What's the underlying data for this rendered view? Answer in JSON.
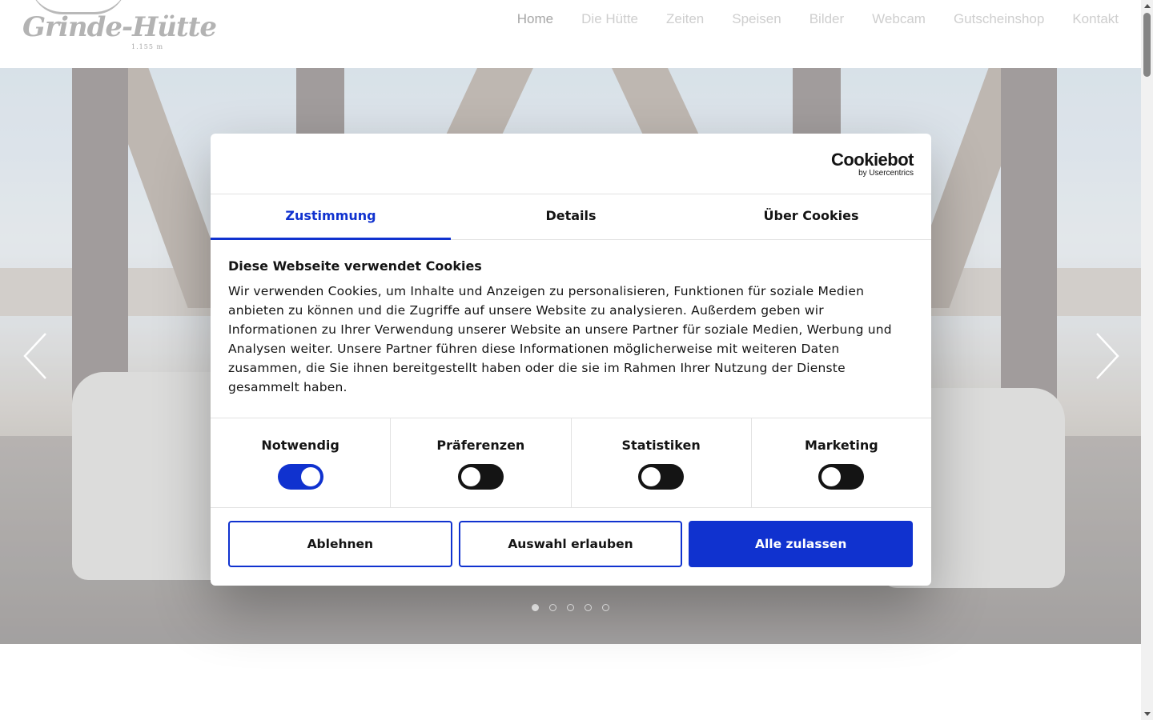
{
  "header": {
    "logo_text": "Grinde-Hütte",
    "logo_sub": "1.155 m",
    "nav": [
      {
        "label": "Home"
      },
      {
        "label": "Die Hütte"
      },
      {
        "label": "Zeiten"
      },
      {
        "label": "Speisen"
      },
      {
        "label": "Bilder"
      },
      {
        "label": "Webcam"
      },
      {
        "label": "Gutscheinshop"
      },
      {
        "label": "Kontakt"
      }
    ],
    "active_nav": "Home"
  },
  "hero": {
    "slide_count": 5,
    "active_slide": 1,
    "prev_icon": "chevron-left-icon",
    "next_icon": "chevron-right-icon"
  },
  "cookie_dialog": {
    "brand": "Cookiebot",
    "brand_by": "by Usercentrics",
    "tabs": [
      {
        "label": "Zustimmung"
      },
      {
        "label": "Details"
      },
      {
        "label": "Über Cookies"
      }
    ],
    "active_tab": "Zustimmung",
    "title": "Diese Webseite verwendet Cookies",
    "text": "Wir verwenden Cookies, um Inhalte und Anzeigen zu personalisieren, Funktionen für soziale Medien anbieten zu können und die Zugriffe auf unsere Website zu analysieren. Außerdem geben wir Informationen zu Ihrer Verwendung unserer Website an unsere Partner für soziale Medien, Werbung und Analysen weiter. Unsere Partner führen diese Informationen möglicherweise mit weiteren Daten zusammen, die Sie ihnen bereitgestellt haben oder die sie im Rahmen Ihrer Nutzung der Dienste gesammelt haben.",
    "categories": [
      {
        "label": "Notwendig",
        "enabled": true
      },
      {
        "label": "Präferenzen",
        "enabled": false
      },
      {
        "label": "Statistiken",
        "enabled": false
      },
      {
        "label": "Marketing",
        "enabled": false
      }
    ],
    "buttons": {
      "decline": "Ablehnen",
      "allow_selection": "Auswahl erlauben",
      "allow_all": "Alle zulassen"
    }
  },
  "colors": {
    "accent": "#1032cf",
    "text": "#141414",
    "nav_inactive": "#c8c8c8",
    "nav_active": "#9a9a9a"
  }
}
